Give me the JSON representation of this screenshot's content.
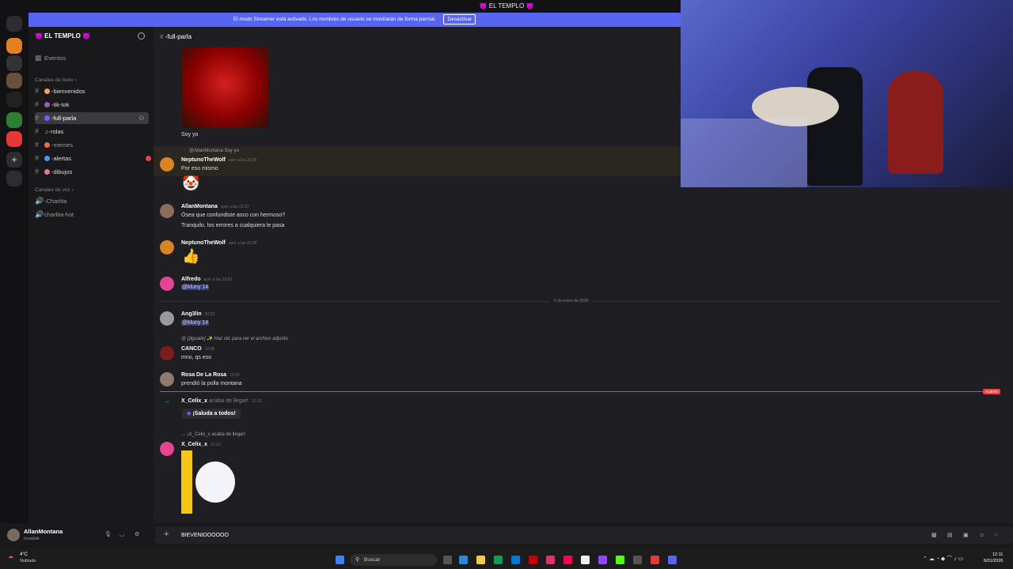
{
  "topbar": {
    "title": "👿 EL TEMPLO 👿"
  },
  "banner": {
    "text": "El modo Streamer está activado. Los nombres de usuario se mostrarán de forma parcial.",
    "button": "Desactivar"
  },
  "server": {
    "name": "👿 EL TEMPLO 👿"
  },
  "sidebar": {
    "events": "Eventos",
    "text_category": "Canales de texto",
    "voice_category": "Canales de voz",
    "channels": [
      "-bienvenidos",
      "-tik-tok",
      "-full-parla",
      "-rolas",
      "-memes",
      "-alertas",
      "-dibujos"
    ],
    "voice": [
      "-Charlita",
      "charlita-hot"
    ]
  },
  "channel": {
    "name": "-full-parla"
  },
  "messages": {
    "m0_text": "Soy yo",
    "m1_reply": "@AllanMontana Soy yo",
    "m1_author": "NeptunoTheWolf",
    "m1_ts": "ayer a las 22:26",
    "m1_text": "Por eso mismo",
    "m2_author": "AllanMontana",
    "m2_ts": "ayer a las 22:37",
    "m2_text1": "Ósea que confundiste asco con hermoso?",
    "m2_text2": "Tranquilo, los errores a cualquiera le pasa",
    "m3_author": "NeptunoTheWolf",
    "m3_ts": "ayer a las 22:38",
    "m4_author": "Alfredo",
    "m4_ts": "ayer a las 23:20",
    "m4_mention": "@kluny 14",
    "date_divider": "6 de enero de 2026",
    "m5_author": "Ang3lin",
    "m5_ts": "02:22",
    "m5_mention": "@kluny 14",
    "m6_reply": "@ [Ꞵgsaile] ✨ Haz clic para ver el archivo adjunto",
    "m6_author": "CANCO",
    "m6_ts": "10:36",
    "m6_text": "mno, qs eso",
    "m7_author": "Rosa De La Rosa",
    "m7_ts": "10:39",
    "m7_text": "prendió la polla montana",
    "new_badge": "NUEVO",
    "m8_author": "X_Celix_x",
    "m8_action": "acaba de llegar!",
    "m8_ts": "12:10",
    "m8_button": "¡Saluda a todos!",
    "m9_reply": "¡X_Celix_x acaba de llegar!",
    "m9_author": "X_Celix_x",
    "m9_ts": "12:10"
  },
  "input": {
    "value": "BIEVENIDOOOOO"
  },
  "user": {
    "name": "AllanMontana",
    "status": "Invisible"
  },
  "taskbar": {
    "weather_temp": "4°C",
    "weather_desc": "Nublado",
    "search": "Buscar",
    "time": "12:11",
    "date": "6/01/2026"
  },
  "colors": {
    "accent": "#5865f2",
    "new": "#f23f43",
    "mention_bg": "#3c4270"
  }
}
